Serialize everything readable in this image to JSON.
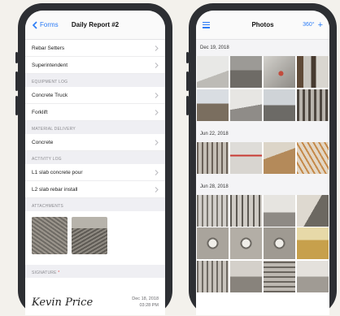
{
  "report": {
    "back_label": "Forms",
    "title": "Daily Report #2",
    "rows_top": [
      "Rebar Setters",
      "Superintendent"
    ],
    "equipment_header": "EQUIPMENT LOG",
    "equipment": [
      "Concrete Truck",
      "Forklift"
    ],
    "material_header": "MATERIAL DELIVERY",
    "material": [
      "Concrete"
    ],
    "activity_header": "ACTIVITY LOG",
    "activity": [
      "L1 slab concrete pour",
      "L2 slab rebar install"
    ],
    "attachments_header": "ATTACHMENTS",
    "signature_header": "SIGNATURE",
    "required_mark": "*",
    "signature_name": "Kevin Price",
    "signature_date": "Dec 18, 2018",
    "signature_time": "03:28 PM"
  },
  "photos": {
    "title": "Photos",
    "view_label": "360°",
    "add_label": "+",
    "groups": [
      {
        "date": "Dec 19, 2018",
        "count": 8
      },
      {
        "date": "Jun 22, 2018",
        "count": 4
      },
      {
        "date": "Jun 28, 2018",
        "count": 12
      }
    ]
  },
  "colors": {
    "accent": "#2a7bf6",
    "frame": "#2d2f33",
    "section_bg": "#efeff3"
  }
}
